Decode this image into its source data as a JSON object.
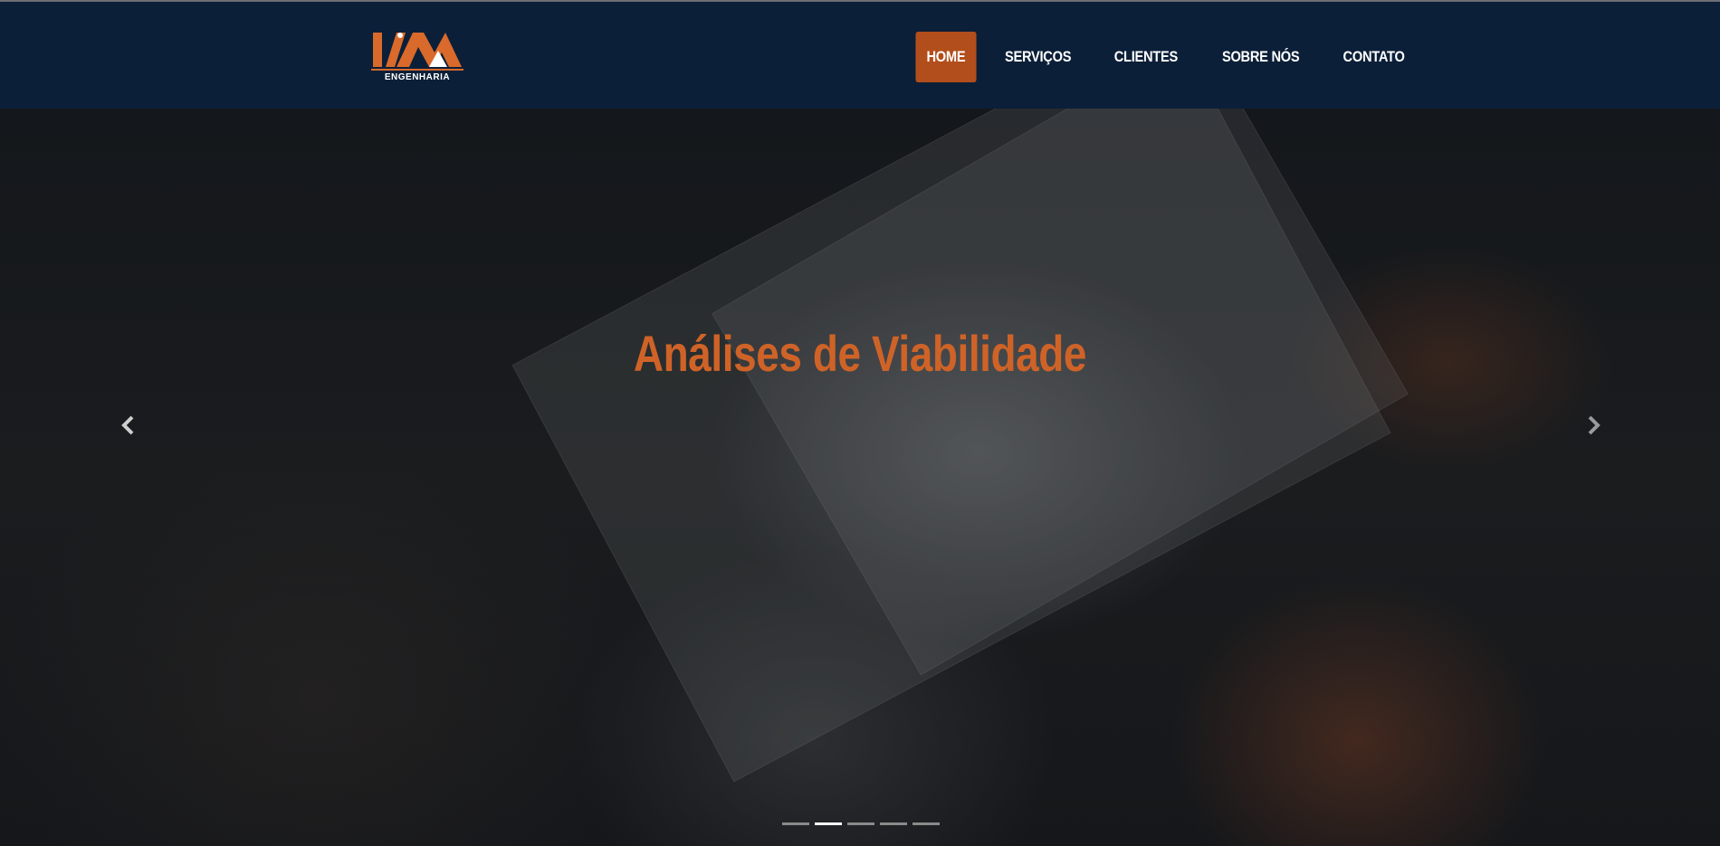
{
  "brand": {
    "logo_text": "ENGENHARIA",
    "colors": {
      "orange": "#d96a2b",
      "navbar": "#0c1f38"
    }
  },
  "nav": {
    "items": [
      {
        "label": "HOME",
        "active": true
      },
      {
        "label": "SERVIÇOS",
        "active": false
      },
      {
        "label": "CLIENTES",
        "active": false
      },
      {
        "label": "SOBRE NÓS",
        "active": false
      },
      {
        "label": "CONTATO",
        "active": false
      }
    ],
    "active_color": "#b24e1c"
  },
  "hero": {
    "title": "Análises de Viabilidade",
    "title_color": "#cf6327",
    "prev_icon": "chevron-left-icon",
    "next_icon": "chevron-right-icon",
    "slide_count": 5,
    "active_slide": 2
  }
}
